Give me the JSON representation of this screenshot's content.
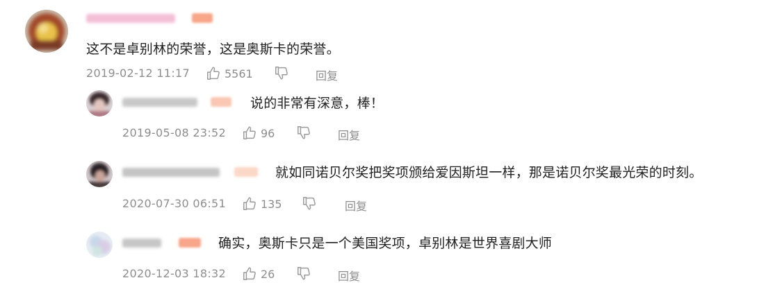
{
  "icons": {
    "like": "thumbs-up-icon",
    "dislike": "thumbs-down-icon"
  },
  "colors": {
    "text": "#1f1f1f",
    "meta": "#8d8d8d",
    "badge": "#f7a68a"
  },
  "comments": [
    {
      "text": "这不是卓别林的荣誉，这是奥斯卡的荣誉。",
      "time": "2019-02-12 11:17",
      "likes": "5561",
      "reply_label": "回复"
    },
    {
      "text": "说的非常有深意，棒！",
      "time": "2019-05-08 23:52",
      "likes": "96",
      "reply_label": "回复"
    },
    {
      "text": "就如同诺贝尔奖把奖项颁给爱因斯坦一样，那是诺贝尔奖最光荣的时刻。",
      "time": "2020-07-30 06:51",
      "likes": "135",
      "reply_label": "回复"
    },
    {
      "text": "确实，奥斯卡只是一个美国奖项，卓别林是世界喜剧大师",
      "time": "2020-12-03 18:32",
      "likes": "26",
      "reply_label": "回复"
    }
  ]
}
